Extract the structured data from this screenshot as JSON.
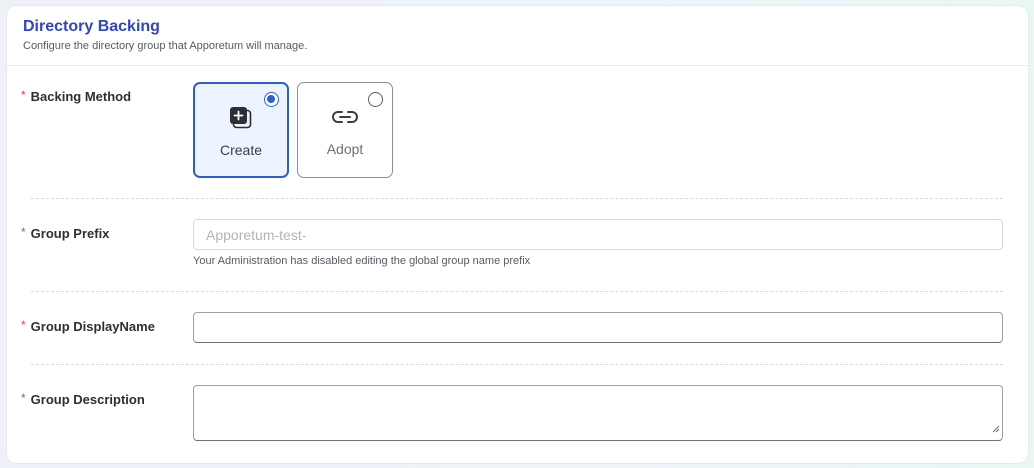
{
  "header": {
    "title": "Directory Backing",
    "subtitle": "Configure the directory group that Apporetum will manage."
  },
  "form": {
    "required_mark": "*",
    "backing_method": {
      "label": "Backing Method",
      "options": [
        {
          "label": "Create",
          "selected": true,
          "icon": "add-copy-icon"
        },
        {
          "label": "Adopt",
          "selected": false,
          "icon": "link-icon"
        }
      ]
    },
    "group_prefix": {
      "label": "Group Prefix",
      "placeholder": "Apporetum-test-",
      "hint": "Your Administration has disabled editing the global group name prefix",
      "disabled": true
    },
    "group_display_name": {
      "label": "Group DisplayName",
      "value": ""
    },
    "group_description": {
      "label": "Group Description",
      "value": ""
    }
  },
  "colors": {
    "accent": "#2b5fd9",
    "title": "#2f45c5",
    "required": "#e0493b"
  }
}
